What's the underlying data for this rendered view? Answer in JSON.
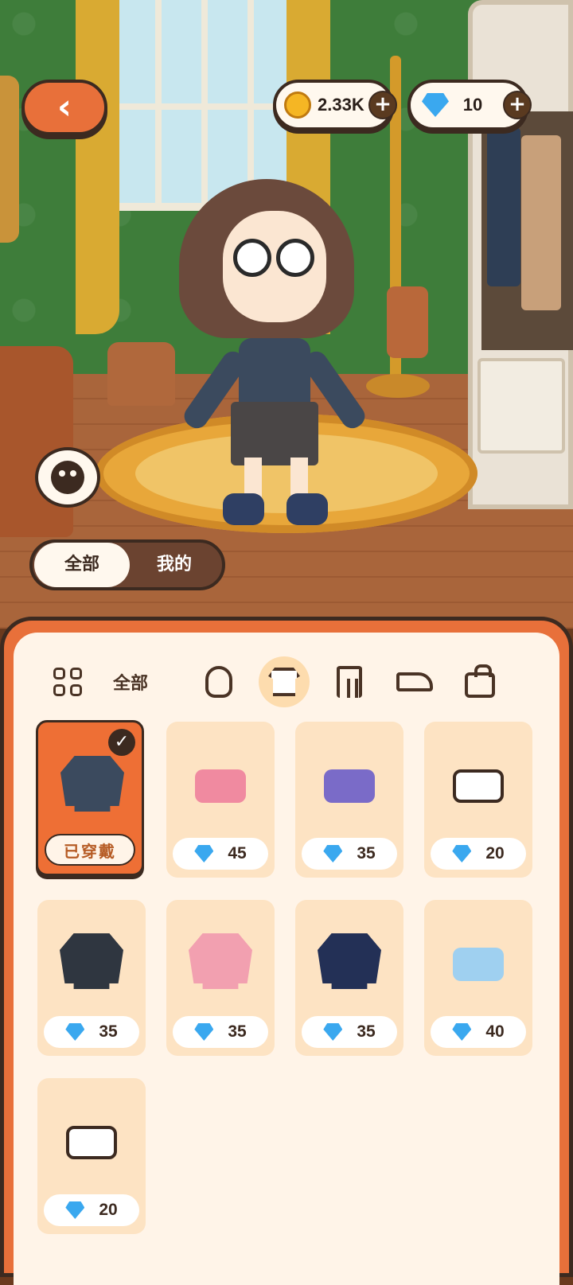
{
  "hud": {
    "coins": "2.33K",
    "gems": "10",
    "plus": "+",
    "back": "‹"
  },
  "filter": {
    "all": "全部",
    "mine": "我的"
  },
  "categories": {
    "all_label": "全部",
    "items": [
      "grid-icon",
      "hair-icon",
      "top-icon",
      "pants-icon",
      "shoe-icon",
      "bag-icon"
    ],
    "active": "top-icon"
  },
  "items": [
    {
      "status": "已穿戴",
      "color": "#3b4a5e",
      "worn": true
    },
    {
      "price": "45",
      "color": "#f08aa0"
    },
    {
      "price": "35",
      "color": "#7a6bc8"
    },
    {
      "price": "20",
      "color": "#ffffff"
    },
    {
      "price": "35",
      "color": "#2f3640"
    },
    {
      "price": "35",
      "color": "#f2a0b0"
    },
    {
      "price": "35",
      "color": "#233056"
    },
    {
      "price": "40",
      "color": "#9fd0f0"
    },
    {
      "price": "20",
      "color": "#ffffff"
    }
  ],
  "colors": {
    "accent": "#e8703a",
    "panel": "#fff4e8",
    "card": "#fde3c3",
    "outline": "#3c2a20",
    "gem": "#3aa8ef",
    "coin": "#f5b624"
  }
}
